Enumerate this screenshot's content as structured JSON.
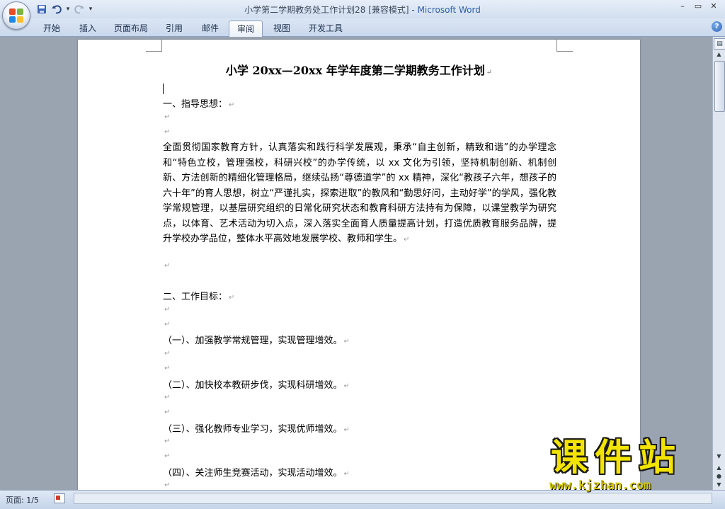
{
  "window": {
    "title_doc": "小学第二学期教务处工作计划28 [兼容模式]",
    "title_sep": " - ",
    "title_app": "Microsoft Word"
  },
  "ribbon": {
    "tabs": [
      {
        "label": "开始",
        "active": false
      },
      {
        "label": "插入",
        "active": false
      },
      {
        "label": "页面布局",
        "active": false
      },
      {
        "label": "引用",
        "active": false
      },
      {
        "label": "邮件",
        "active": false
      },
      {
        "label": "审阅",
        "active": true
      },
      {
        "label": "视图",
        "active": false
      },
      {
        "label": "开发工具",
        "active": false
      }
    ]
  },
  "document": {
    "title": "小学 20xx—20xx 年学年度第二学期教务工作计划",
    "section1_heading": "一、指导思想：",
    "paragraph": "全面贯彻国家教育方针，认真落实和践行科学发展观，秉承“自主创新，精致和谐”的办学理念和“特色立校，管理强校，科研兴校”的办学传统，以 xx 文化为引领，坚持机制创新、机制创新、方法创新的精细化管理格局，继续弘扬“尊德道学”的 xx 精神，深化“教孩子六年，想孩子的六十年”的育人思想，树立“严谨扎实，探索进取”的教风和“勤思好问，主动好学”的学风，强化教学常规管理，以基层研究组织的日常化研究状态和教育科研方法持有为保障，以课堂教学为研究点，以体育、艺术活动为切入点，深入落实全面育人质量提高计划，打造优质教育服务品牌，提升学校办学品位，整体水平高效地发展学校、教师和学生。",
    "section2_heading": "二、工作目标：",
    "goal1": "（一）、加强教学常规管理，实现管理增效。",
    "goal2": "（二）、加快校本教研步伐，实现科研增效。",
    "goal3": "（三）、强化教师专业学习，实现优师增效。",
    "goal4": "（四）、关注师生竞赛活动，实现活动增效。",
    "para_mark": "↵"
  },
  "status": {
    "page_indicator": "页面: 1/5"
  },
  "watermark": {
    "cn": "课件站",
    "url": "www.kjzhan.com"
  }
}
